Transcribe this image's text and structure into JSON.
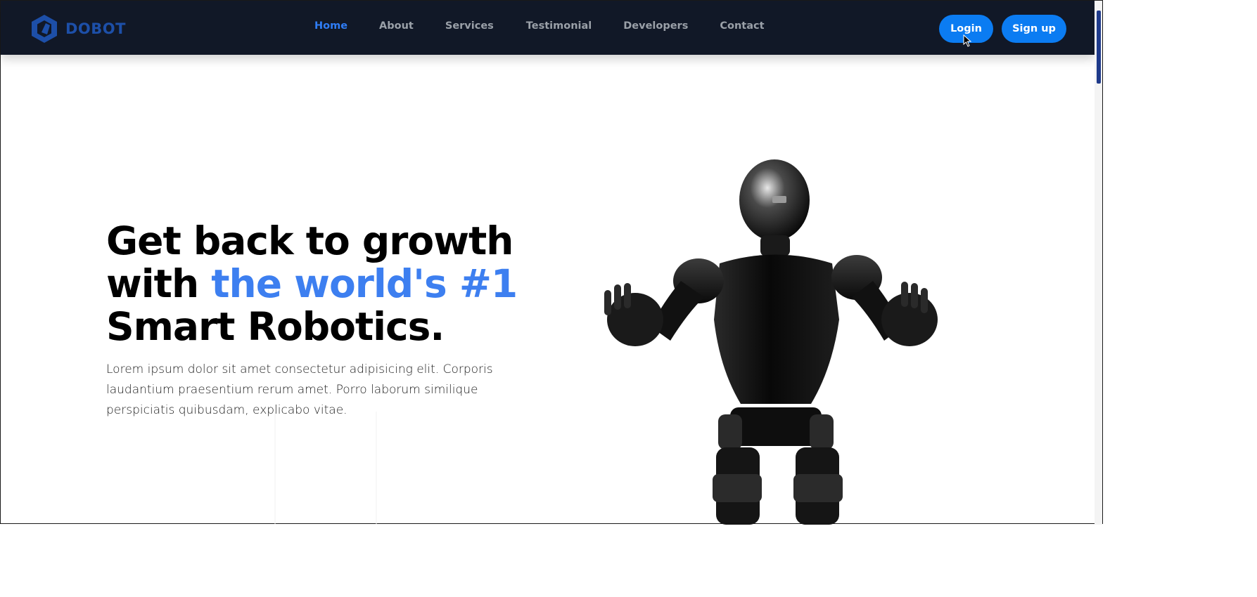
{
  "brand": {
    "name": "DOBOT"
  },
  "nav": {
    "links": [
      {
        "label": "Home",
        "active": true
      },
      {
        "label": "About",
        "active": false
      },
      {
        "label": "Services",
        "active": false
      },
      {
        "label": "Testimonial",
        "active": false
      },
      {
        "label": "Developers",
        "active": false
      },
      {
        "label": "Contact",
        "active": false
      }
    ],
    "login_label": "Login",
    "signup_label": "Sign up"
  },
  "hero": {
    "title_line1": "Get back to growth",
    "title_line2_prefix": "with ",
    "title_line2_accent": "the world's #1",
    "title_line3": "Smart Robotics.",
    "description": "Lorem ipsum dolor sit amet consectetur adipisicing elit. Corporis laudantium praesentium rerum amet. Porro laborum similique perspiciatis quibusdam, explicabo vitae."
  },
  "colors": {
    "navbar_bg": "#111827",
    "accent": "#3d7ff0",
    "button": "#0b7cf2",
    "nav_text": "#9aa0a8"
  },
  "icons": {
    "brand": "hexagon-logo-icon",
    "cursor": "mouse-cursor-icon"
  }
}
